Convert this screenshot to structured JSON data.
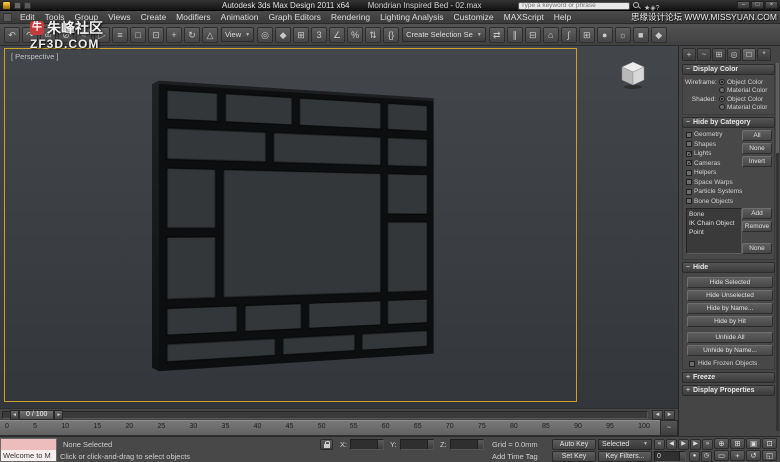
{
  "watermarks": {
    "top_left_logo": "牛",
    "top_left_line1": "朱峰社区",
    "top_left_line2": "ZF3D.COM",
    "top_right": "思缘设计论坛 WWW.MISSYUAN.COM"
  },
  "title_bar": {
    "app_title": "Autodesk 3ds Max Design 2011 x64",
    "doc_title": "Mondrian Inspired Bed - 02.max",
    "search_placeholder": "Type a keyword or phrase",
    "ic_icons": [
      {
        "name": "favorites-star-icon",
        "glyph": "★"
      },
      {
        "name": "communication-center-icon",
        "glyph": "◈"
      },
      {
        "name": "help-icon",
        "glyph": "?"
      }
    ],
    "window_buttons": [
      {
        "name": "minimize-button",
        "glyph": "–"
      },
      {
        "name": "maximize-button",
        "glyph": "□"
      },
      {
        "name": "close-button",
        "glyph": "×"
      }
    ]
  },
  "menus": {
    "items": [
      "Edit",
      "Tools",
      "Group",
      "Views",
      "Create",
      "Modifiers",
      "Animation",
      "Graph Editors",
      "Rendering",
      "Lighting Analysis",
      "Customize",
      "MAXScript",
      "Help"
    ]
  },
  "toolbar": {
    "dropdown_arrow": "▼",
    "group1": [
      {
        "name": "undo-icon",
        "glyph": "↶"
      },
      {
        "name": "redo-icon",
        "glyph": "↷"
      },
      {
        "name": "select-and-link-icon",
        "glyph": "∞"
      },
      {
        "name": "unlink-selection-icon",
        "glyph": "⊘"
      },
      {
        "name": "bind-to-space-warp-icon",
        "glyph": "≈"
      },
      {
        "name": "select-object-icon",
        "glyph": "▷"
      },
      {
        "name": "select-by-name-icon",
        "glyph": "≡"
      },
      {
        "name": "rectangular-selection-region-icon",
        "glyph": "□"
      },
      {
        "name": "window-crossing-icon",
        "glyph": "⊡"
      },
      {
        "name": "select-and-move-icon",
        "glyph": "+"
      },
      {
        "name": "select-and-rotate-icon",
        "glyph": "↻"
      },
      {
        "name": "select-and-scale-icon",
        "glyph": "△"
      }
    ],
    "coord_dropdown": "View",
    "group2": [
      {
        "name": "use-pivot-center-icon",
        "glyph": "◎"
      },
      {
        "name": "select-and-manipulate-icon",
        "glyph": "◆"
      },
      {
        "name": "keyboard-override-icon",
        "glyph": "⊞"
      },
      {
        "name": "snap-toggle-3d-icon",
        "glyph": "3"
      },
      {
        "name": "angle-snap-icon",
        "glyph": "∠"
      },
      {
        "name": "percent-snap-icon",
        "glyph": "%"
      },
      {
        "name": "spinner-snap-icon",
        "glyph": "⇅"
      },
      {
        "name": "edit-named-selection-sets-icon",
        "glyph": "{}"
      }
    ],
    "selection_set_dropdown": "Create Selection Se",
    "group3": [
      {
        "name": "mirror-icon",
        "glyph": "⇄"
      },
      {
        "name": "align-icon",
        "glyph": "∥"
      },
      {
        "name": "layer-manager-icon",
        "glyph": "⊟"
      },
      {
        "name": "graphite-modeling-tools-icon",
        "glyph": "⌂"
      },
      {
        "name": "curve-editor-icon",
        "glyph": "∫"
      },
      {
        "name": "schematic-view-icon",
        "glyph": "⊞"
      },
      {
        "name": "material-editor-icon",
        "glyph": "●"
      },
      {
        "name": "render-setup-icon",
        "glyph": "☼"
      },
      {
        "name": "rendered-frame-window-icon",
        "glyph": "■"
      },
      {
        "name": "render-production-icon",
        "glyph": "◆"
      }
    ]
  },
  "viewport": {
    "label": "[ Perspective ]"
  },
  "command_panel": {
    "tabs": [
      {
        "name": "create-tab",
        "glyph": "+"
      },
      {
        "name": "modify-tab",
        "glyph": "~"
      },
      {
        "name": "hierarchy-tab",
        "glyph": "⊞"
      },
      {
        "name": "motion-tab",
        "glyph": "◎"
      },
      {
        "name": "display-tab",
        "glyph": "□",
        "active": true
      },
      {
        "name": "utilities-tab",
        "glyph": "*"
      }
    ],
    "display_color": {
      "pm": "−",
      "title": "Display Color",
      "wireframe_label": "Wireframe:",
      "shaded_label": "Shaded:",
      "wireframe_options": [
        {
          "label": "Object Color",
          "selected": true
        },
        {
          "label": "Material Color"
        }
      ],
      "shaded_options": [
        {
          "label": "Object Color",
          "selected": true
        },
        {
          "label": "Material Color"
        }
      ]
    },
    "hide_by_category": {
      "pm": "−",
      "title": "Hide by Category",
      "categories": [
        {
          "label": "Geometry"
        },
        {
          "label": "Shapes"
        },
        {
          "label": "Lights",
          "checked": true
        },
        {
          "label": "Cameras",
          "checked": true
        },
        {
          "label": "Helpers"
        },
        {
          "label": "Space Warps"
        },
        {
          "label": "Particle Systems"
        },
        {
          "label": "Bone Objects"
        }
      ],
      "side_buttons": [
        "All",
        "None",
        "Invert"
      ],
      "list_items": [
        "Bone",
        "IK Chain Object",
        "Point"
      ],
      "add_button": "Add",
      "remove_button": "Remove",
      "none_button": "None"
    },
    "hide": {
      "pm": "−",
      "title": "Hide",
      "buttons": [
        "Hide Selected",
        "Hide Unselected",
        "Hide by Name...",
        "Hide by Hit",
        "Unhide All",
        "Unhide by Name..."
      ],
      "frozen_label": "Hide Frozen Objects"
    },
    "freeze": {
      "pm": "+",
      "title": "Freeze"
    },
    "display_properties": {
      "pm": "+",
      "title": "Display Properties"
    }
  },
  "timeline": {
    "slider_value": "0 / 100",
    "arrow_left": "◄",
    "arrow_right": "►",
    "ticks": [
      "0",
      "5",
      "10",
      "15",
      "20",
      "25",
      "30",
      "35",
      "40",
      "45",
      "50",
      "55",
      "60",
      "65",
      "70",
      "75",
      "80",
      "85",
      "90",
      "95",
      "100"
    ],
    "mini_curve_editor_glyph": "~"
  },
  "status_bar": {
    "listener_text": "Welcome to M",
    "selection_status": "None Selected",
    "prompt": "Click or click-and-drag to select objects",
    "cursor_glyph": "▸",
    "x_label": "X:",
    "y_label": "Y:",
    "z_label": "Z:",
    "x_value": "",
    "y_value": "",
    "z_value": "",
    "grid_status": "Grid = 0.0mm",
    "add_time_tag": "Add Time Tag",
    "auto_key_label": "Auto Key",
    "set_key_label": "Set Key",
    "selected_dropdown": "Selected",
    "dropdown_arrow": "▼",
    "key_filters_label": "Key Filters...",
    "frame_value": "0",
    "playback": [
      {
        "name": "go-to-start-button",
        "glyph": "«"
      },
      {
        "name": "previous-frame-button",
        "glyph": "◀"
      },
      {
        "name": "play-button",
        "glyph": "▶",
        "active": true
      },
      {
        "name": "next-frame-button",
        "glyph": "▶"
      },
      {
        "name": "go-to-end-button",
        "glyph": "»"
      }
    ],
    "frame_row_icons": [
      {
        "name": "key-mode-toggle-button",
        "glyph": "●"
      },
      {
        "name": "time-configuration-button",
        "glyph": "◷"
      }
    ],
    "nav_icons": [
      {
        "name": "zoom-icon",
        "glyph": "⊕"
      },
      {
        "name": "zoom-all-icon",
        "glyph": "⊞"
      },
      {
        "name": "zoom-extents-icon",
        "glyph": "▣"
      },
      {
        "name": "zoom-extents-all-icon",
        "glyph": "⊡"
      },
      {
        "name": "zoom-region-icon",
        "glyph": "▭"
      },
      {
        "name": "pan-icon",
        "glyph": "+"
      },
      {
        "name": "orbit-icon",
        "glyph": "↺"
      },
      {
        "name": "maximize-viewport-icon",
        "glyph": "◱"
      }
    ]
  }
}
